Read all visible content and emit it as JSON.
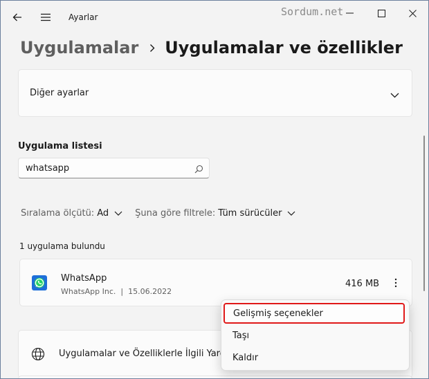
{
  "window": {
    "title": "Ayarlar",
    "watermark": "Sordum.net"
  },
  "breadcrumb": {
    "parent": "Uygulamalar",
    "current": "Uygulamalar ve özellikler"
  },
  "other_settings": {
    "label": "Diğer ayarlar"
  },
  "app_list": {
    "title": "Uygulama listesi",
    "search_value": "whatsapp"
  },
  "filters": {
    "sort_label": "Sıralama ölçütü:",
    "sort_value": "Ad",
    "filter_label": "Şuna göre filtrele:",
    "filter_value": "Tüm sürücüler"
  },
  "result_count": "1 uygulama bulundu",
  "app": {
    "name": "WhatsApp",
    "publisher": "WhatsApp Inc.",
    "separator": "|",
    "date": "15.06.2022",
    "size": "416 MB"
  },
  "related": {
    "label": "Uygulamalar ve Özelliklerle İlgili Yardım"
  },
  "context_menu": {
    "items": [
      {
        "label": "Gelişmiş seçenekler",
        "highlighted": true
      },
      {
        "label": "Taşı"
      },
      {
        "label": "Kaldır"
      }
    ]
  },
  "colors": {
    "accent_highlight": "#e01818",
    "whatsapp_blue": "#1e6fd9",
    "whatsapp_green": "#25d366"
  },
  "icons": {
    "back": "back-arrow-icon",
    "menu": "hamburger-menu-icon",
    "search": "search-icon",
    "globe": "globe-icon",
    "more": "more-vertical-icon"
  }
}
